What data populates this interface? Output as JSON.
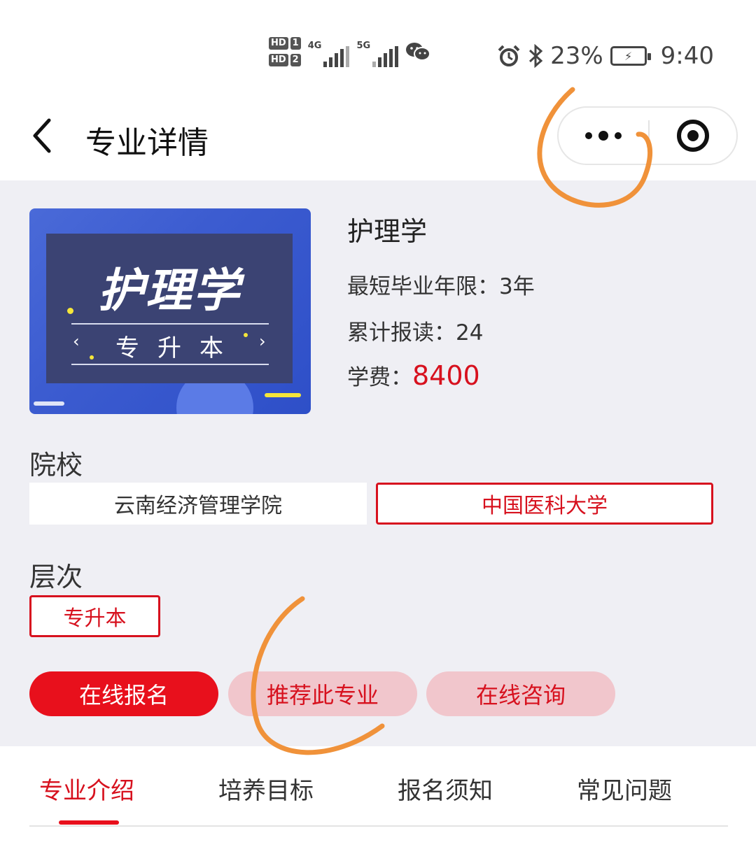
{
  "status_bar": {
    "hd1": "HD",
    "sim1": "1",
    "hd2": "HD",
    "sim2": "2",
    "net1": "4G",
    "net2": "5G",
    "battery_percent": "23%",
    "time": "9:40",
    "icons": [
      "alarm-icon",
      "bluetooth-icon",
      "wechat-icon",
      "battery-icon",
      "signal-icon"
    ]
  },
  "nav": {
    "title": "专业详情",
    "icons": [
      "back-arrow-icon",
      "more-dots-icon",
      "target-close-icon"
    ]
  },
  "cover": {
    "title": "护理学",
    "subtitle": "专升本",
    "arrow_left": "‹",
    "arrow_right": "›"
  },
  "major": {
    "name": "护理学",
    "min_years_label": "最短毕业年限：",
    "min_years_value": "3年",
    "enrolled_label": "累计报读：",
    "enrolled_value": "24",
    "fee_label": "学费：",
    "fee_value": "8400"
  },
  "school": {
    "label": "院校",
    "options": [
      "云南经济管理学院",
      "中国医科大学"
    ],
    "selected": "中国医科大学"
  },
  "level": {
    "label": "层次",
    "options": [
      "专升本"
    ],
    "selected": "专升本"
  },
  "actions": {
    "signup": "在线报名",
    "recommend": "推荐此专业",
    "consult": "在线咨询"
  },
  "tabs": {
    "items": [
      "专业介绍",
      "培养目标",
      "报名须知",
      "常见问题"
    ],
    "active": "专业介绍"
  },
  "colors": {
    "accent": "#e8101c",
    "accent_soft": "#f1c6cc",
    "annotation": "#f0923a",
    "background": "#efeff4"
  }
}
